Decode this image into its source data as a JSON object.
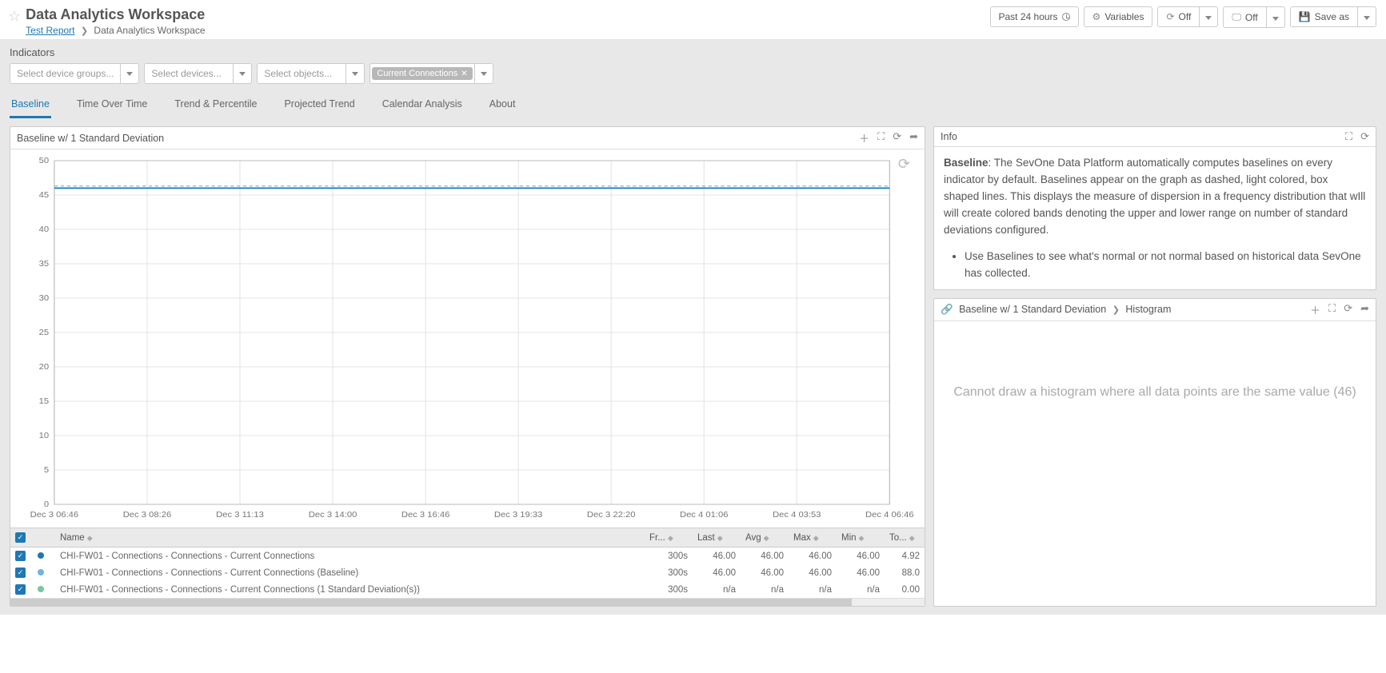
{
  "header": {
    "title": "Data Analytics Workspace",
    "breadcrumb_link": "Test Report",
    "breadcrumb_current": "Data Analytics Workspace",
    "actions": {
      "timerange": "Past 24 hours",
      "variables": "Variables",
      "off1": "Off",
      "off2": "Off",
      "saveas": "Save as"
    }
  },
  "indicators": {
    "label": "Indicators",
    "selectors": {
      "device_groups_ph": "Select device groups...",
      "devices_ph": "Select devices...",
      "objects_ph": "Select objects...",
      "chip1": "Current Connections"
    }
  },
  "tabs": [
    "Baseline",
    "Time Over Time",
    "Trend & Percentile",
    "Projected Trend",
    "Calendar Analysis",
    "About"
  ],
  "active_tab": 0,
  "chart_panel": {
    "title": "Baseline w/ 1 Standard Deviation"
  },
  "chart_data": {
    "type": "line",
    "title": "",
    "xlabel": "",
    "ylabel": "",
    "ylim": [
      0,
      50
    ],
    "y_ticks": [
      0,
      5,
      10,
      15,
      20,
      25,
      30,
      35,
      40,
      45,
      50
    ],
    "categories": [
      "Dec 3 06:46",
      "Dec 3 08:26",
      "Dec 3 11:13",
      "Dec 3 14:00",
      "Dec 3 16:46",
      "Dec 3 19:33",
      "Dec 3 22:20",
      "Dec 4 01:06",
      "Dec 4 03:53",
      "Dec 4 06:46"
    ],
    "series": [
      {
        "name": "Current Connections",
        "style": "solid",
        "color": "#1f78b4",
        "values": [
          46,
          46,
          46,
          46,
          46,
          46,
          46,
          46,
          46,
          46
        ]
      },
      {
        "name": "Baseline",
        "style": "dashed",
        "color": "#6fb3e0",
        "values": [
          46.3,
          46.3,
          46.3,
          46.3,
          46.3,
          46.3,
          46.3,
          46.3,
          46.3,
          46.3
        ]
      }
    ]
  },
  "grid": {
    "headers": [
      "",
      "",
      "Name",
      "Fr...",
      "Last",
      "Avg",
      "Max",
      "Min",
      "To..."
    ],
    "rows": [
      {
        "color": "#1f78b4",
        "name": "CHI-FW01 - Connections - Connections - Current Connections",
        "fr": "300s",
        "last": "46.00",
        "avg": "46.00",
        "max": "46.00",
        "min": "46.00",
        "to": "4.92"
      },
      {
        "color": "#6fb3e0",
        "name": "CHI-FW01 - Connections - Connections - Current Connections (Baseline)",
        "fr": "300s",
        "last": "46.00",
        "avg": "46.00",
        "max": "46.00",
        "min": "46.00",
        "to": "88.0"
      },
      {
        "color": "#78c6a3",
        "name": "CHI-FW01 - Connections - Connections - Current Connections (1 Standard Deviation(s))",
        "fr": "300s",
        "last": "n/a",
        "avg": "n/a",
        "max": "n/a",
        "min": "n/a",
        "to": "0.00"
      }
    ]
  },
  "info_panel": {
    "title": "Info",
    "bold": "Baseline",
    "body": ": The SevOne Data Platform automatically computes baselines on every indicator by default. Baselines appear on the graph as dashed, light colored, box shaped lines. This displays the measure of dispersion in a frequency distribution that wIll will create colored bands denoting the upper and lower range on number of standard deviations configured.",
    "bullet": "Use Baselines to see what's normal or not normal based on historical data SevOne has collected."
  },
  "histogram_panel": {
    "link_text": "Baseline w/ 1 Standard Deviation",
    "crumb": "Histogram",
    "body": "Cannot draw a histogram where all data points are the same value (46)"
  }
}
